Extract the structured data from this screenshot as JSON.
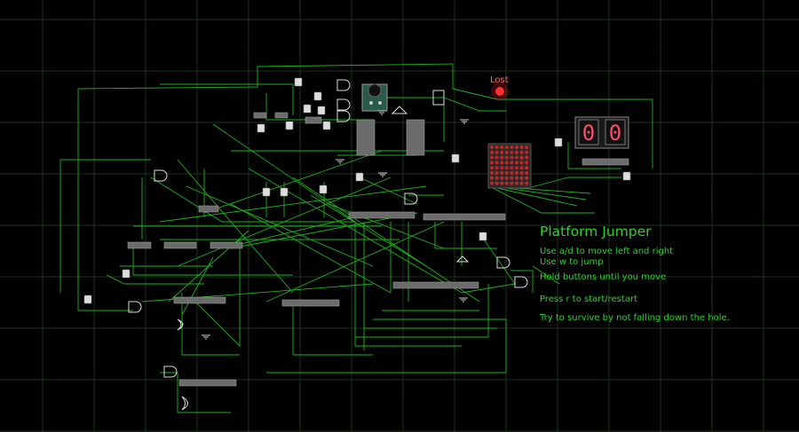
{
  "game": {
    "title": "Platform Jumper",
    "instructions": [
      "Use a/d to move left and right",
      "Use w to jump",
      "Hold buttons until you move",
      "Press r to start/restart",
      "Try to survive by not falling down the hole."
    ],
    "status_label": "Lost",
    "score_digits": [
      "0",
      "0"
    ]
  },
  "colors": {
    "background": "#000000",
    "grid": "#1c3a1c",
    "wire": "#22c422",
    "text": "#2bd32b",
    "status_led": "#ff2020",
    "chip": "#6b6b6b",
    "seven_segment": "#ff4a6a",
    "led_matrix": "#ff3030"
  },
  "icons": [
    "led-icon",
    "buzzer-icon",
    "seven-segment-display-icon",
    "led-matrix-icon",
    "and-gate-icon",
    "or-gate-icon",
    "ground-icon",
    "button-icon"
  ]
}
